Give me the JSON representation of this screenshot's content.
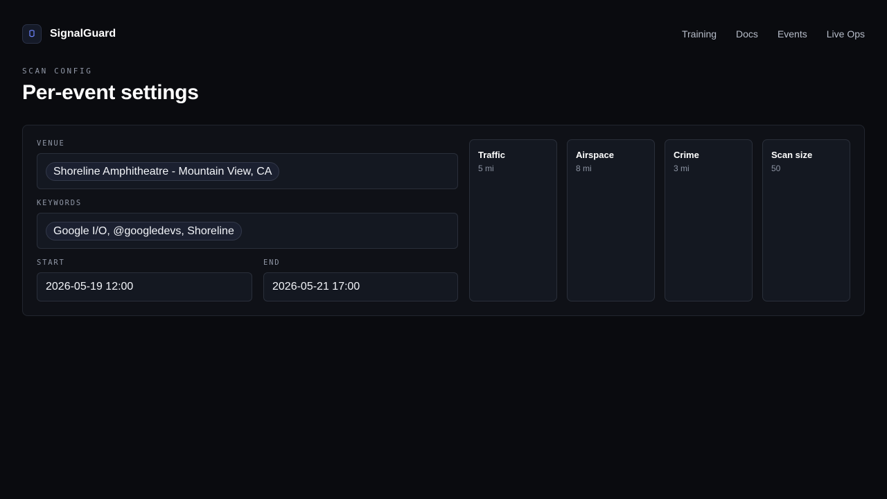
{
  "app": {
    "logo_icon": "shield-icon",
    "name": "SignalGuard"
  },
  "nav": {
    "items": [
      {
        "label": "Training"
      },
      {
        "label": "Docs"
      },
      {
        "label": "Events"
      },
      {
        "label": "Live Ops"
      }
    ]
  },
  "page": {
    "eyebrow": "SCAN CONFIG",
    "title": "Per-event settings"
  },
  "form": {
    "venue": {
      "label": "VENUE",
      "value": "Shoreline Amphitheatre - Mountain View, CA"
    },
    "keywords": {
      "label": "KEYWORDS",
      "value": "Google I/O, @googledevs, Shoreline"
    },
    "start": {
      "label": "START",
      "value": "2026-05-19 12:00"
    },
    "end": {
      "label": "END",
      "value": "2026-05-21 17:00"
    }
  },
  "layers": [
    {
      "name": "Traffic",
      "value": "5 mi"
    },
    {
      "name": "Airspace",
      "value": "8 mi"
    },
    {
      "name": "Crime",
      "value": "3 mi"
    },
    {
      "name": "Scan size",
      "value": "50"
    }
  ],
  "colors": {
    "background": "#0a0b0f",
    "panel": "#0f1117",
    "field": "#141821",
    "logo_accent": "#6f86ff"
  }
}
